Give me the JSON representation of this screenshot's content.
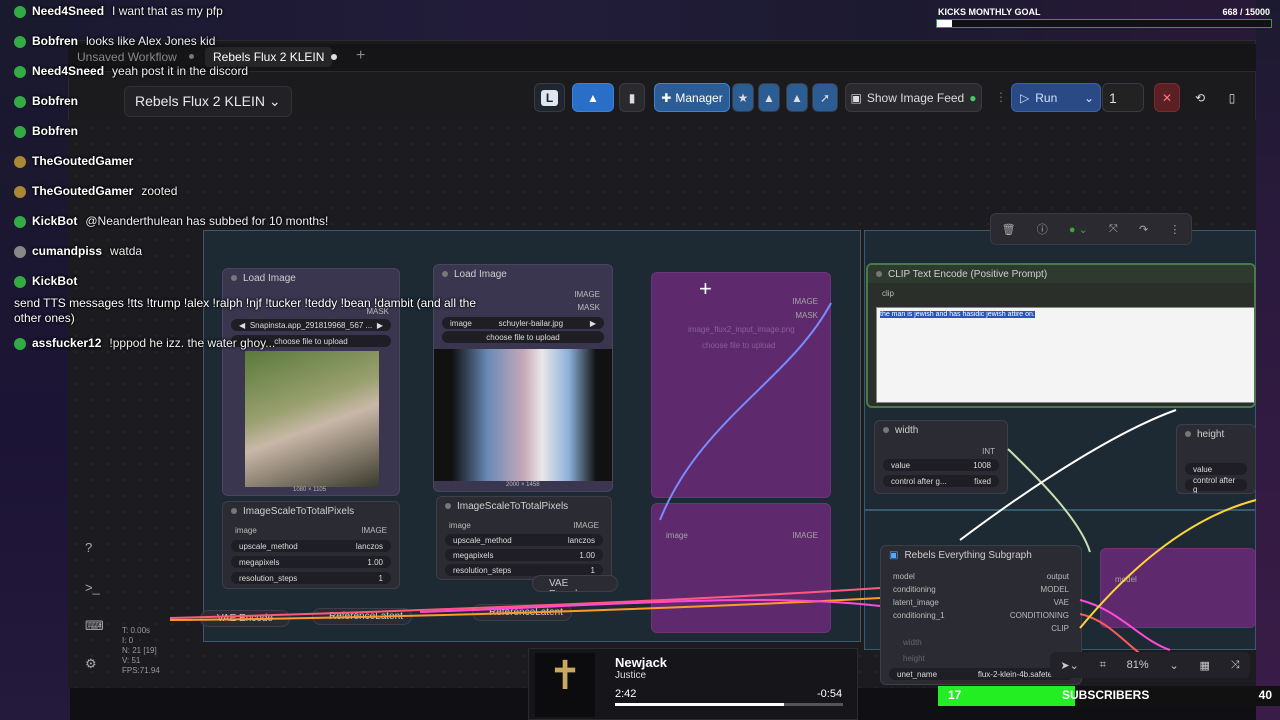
{
  "chat": [
    {
      "user": "Need4Sneed",
      "msg": "I want that as my pfp"
    },
    {
      "user": "Bobfren",
      "msg": "looks like Alex Jones kid"
    },
    {
      "user": "Need4Sneed",
      "msg": "yeah post it in the discord"
    },
    {
      "user": "Bobfren",
      "msg": ""
    },
    {
      "user": "Bobfren",
      "msg": ""
    },
    {
      "user": "TheGoutedGamer",
      "msg": ""
    },
    {
      "user": "TheGoutedGamer",
      "msg": "zooted"
    },
    {
      "user": "KickBot",
      "msg": "@Neanderthulean has subbed for 10 months!"
    },
    {
      "user": "cumandpiss",
      "msg": "watda"
    },
    {
      "user": "KickBot",
      "msg": ""
    },
    {
      "user": "assfucker12",
      "msg": "!pppod he izz. the water ghoy..."
    }
  ],
  "tts_line1": "send TTS messages !tts !trump !alex !ralph !njf !tucker !teddy !bean !dambit (and all the",
  "tts_line2": "other ones)",
  "goal": {
    "label": "KICKS MONTHLY GOAL",
    "value": "668 / 15000",
    "progress": 0.045
  },
  "tabs": {
    "unsaved": "Unsaved Workflow",
    "active": "Rebels Flux 2 KLEIN",
    "add": "+"
  },
  "workflow_title": "Rebels Flux 2 KLEIN",
  "toolbar": {
    "letter": "L",
    "manager": "Manager",
    "feed": "Show Image Feed",
    "run": "Run",
    "queue_count": "1"
  },
  "nodes": {
    "load1": {
      "title": "Load Image",
      "file": "Snapinsta.app_291819968_567 ...",
      "upload": "choose file to upload",
      "mask": "MASK",
      "dims": "1080 × 1105"
    },
    "load2": {
      "title": "Load Image",
      "image_label": "image",
      "file": "schuyler-bailar.jpg",
      "upload": "choose file to upload",
      "out1": "IMAGE",
      "out2": "MASK",
      "dims": "2000 × 1458"
    },
    "scale1": {
      "title": "ImageScaleToTotalPixels",
      "in": "image",
      "out": "IMAGE",
      "method_label": "upscale_method",
      "method": "lanczos",
      "mp_label": "megapixels",
      "mp": "1.00",
      "res_label": "resolution_steps",
      "res": "1"
    },
    "scale2": {
      "title": "ImageScaleToTotalPixels",
      "in": "image",
      "out": "IMAGE",
      "method_label": "upscale_method",
      "method": "lanczos",
      "mp_label": "megapixels",
      "mp": "1.00",
      "res_label": "resolution_steps",
      "res": "1"
    },
    "bypassed": {
      "out1": "IMAGE",
      "out2": "MASK",
      "file": "image_flux2_input_image.png",
      "upload": "choose file to upload",
      "in": "image",
      "out3": "IMAGE"
    },
    "clip": {
      "title": "CLIP Text Encode (Positive Prompt)",
      "in": "clip",
      "text": "the man is jewish and has hasidic jewish attire on."
    },
    "width": {
      "title": "width",
      "out": "INT",
      "value_label": "value",
      "value": "1008",
      "ctrl_label": "control after g...",
      "ctrl": "fixed"
    },
    "height": {
      "title": "height",
      "value_label": "value",
      "ctrl_label": "control after g"
    },
    "subgraph": {
      "title": "Rebels Everything Subgraph",
      "inputs": [
        "model",
        "conditioning",
        "latent_image",
        "conditioning_1"
      ],
      "outputs": [
        "output",
        "MODEL",
        "VAE",
        "CONDITIONING",
        "CLIP"
      ],
      "w1": "width",
      "w2": "height",
      "unet_label": "unet_name",
      "unet": "flux-2-klein-4b.safetenso"
    },
    "vae1": "VAE Encode",
    "vae2": "VAE Encode",
    "ref1": "ReferenceLatent",
    "ref2": "ReferenceLatent",
    "right_model": "model"
  },
  "stats": [
    "T: 0.00s",
    "I: 0",
    "N: 21 [19]",
    "V: 51",
    "FPS:71.94"
  ],
  "zoom": "81%",
  "media": {
    "artist": "Newjack",
    "track": "Justice",
    "elapsed": "2:42",
    "remaining": "-0:54",
    "progress": 0.74
  },
  "subs": {
    "count": "17",
    "label": "SUBSCRIBERS",
    "goal": "40",
    "progress": 0.4
  },
  "colors": {
    "accent": "#2a6fc7",
    "goal_green": "#22ee22",
    "bypass": "#6a2a78"
  }
}
